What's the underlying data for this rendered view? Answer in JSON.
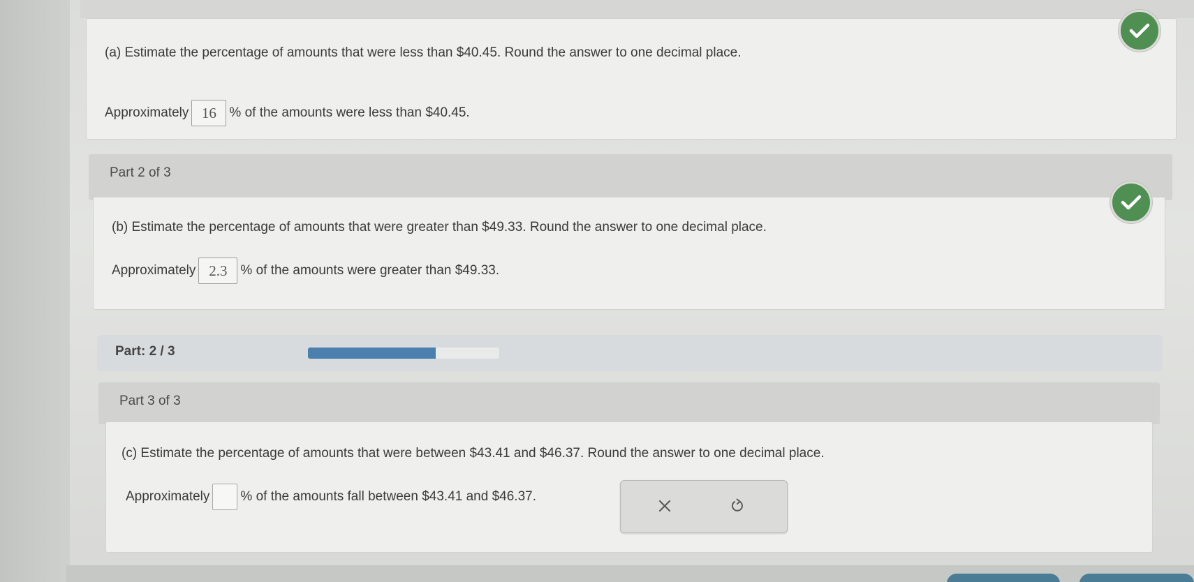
{
  "part1": {
    "question": "(a) Estimate the percentage of amounts that were less than $40.45. Round the answer to one decimal place.",
    "answer_prefix": "Approximately",
    "answer_value": "16",
    "answer_suffix": "% of the amounts were less than $40.45.",
    "status_icon": "checkmark-icon"
  },
  "part2": {
    "header": "Part 2 of 3",
    "question": "(b) Estimate the percentage of amounts that were greater than $49.33. Round the answer to one decimal place.",
    "answer_prefix": "Approximately",
    "answer_value": "2.3",
    "answer_suffix": "% of the amounts were greater than $49.33.",
    "status_icon": "checkmark-icon"
  },
  "progress": {
    "label": "Part: 2 / 3",
    "fraction": 0.667
  },
  "part3": {
    "header": "Part 3 of 3",
    "question": "(c) Estimate the percentage of amounts that were between $43.41 and $46.37. Round the answer to one decimal place.",
    "answer_prefix": "Approximately",
    "answer_value": "",
    "answer_suffix": "% of the amounts fall between $43.41 and $46.37."
  },
  "tools": {
    "clear_icon": "x-icon",
    "reset_icon": "undo-icon"
  },
  "colors": {
    "check_green": "#4f8f52",
    "progress_blue": "#4b7fae"
  }
}
